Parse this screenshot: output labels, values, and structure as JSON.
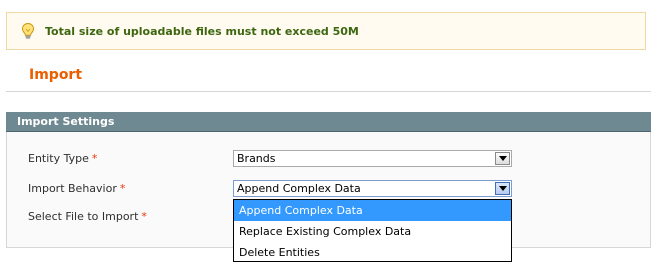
{
  "notice": {
    "icon": "lightbulb-icon",
    "message": "Total size of uploadable files must not exceed 50M"
  },
  "page": {
    "title": "Import"
  },
  "fieldset": {
    "title": "Import Settings",
    "fields": {
      "entity_type": {
        "label": "Entity Type",
        "required_mark": "*",
        "value": "Brands"
      },
      "import_behavior": {
        "label": "Import Behavior",
        "required_mark": "*",
        "value": "Append Complex Data",
        "options": [
          "Append Complex Data",
          "Replace Existing Complex Data",
          "Delete Entities"
        ],
        "highlighted_option": "Append Complex Data"
      },
      "select_file": {
        "label": "Select File to Import",
        "required_mark": "*"
      }
    }
  },
  "colors": {
    "accent_heading": "#eb5e00",
    "fieldset_header": "#6f8992",
    "notice_bg": "#fffbf0",
    "notice_text": "#3d6611",
    "selected_option": "#3399ff"
  }
}
